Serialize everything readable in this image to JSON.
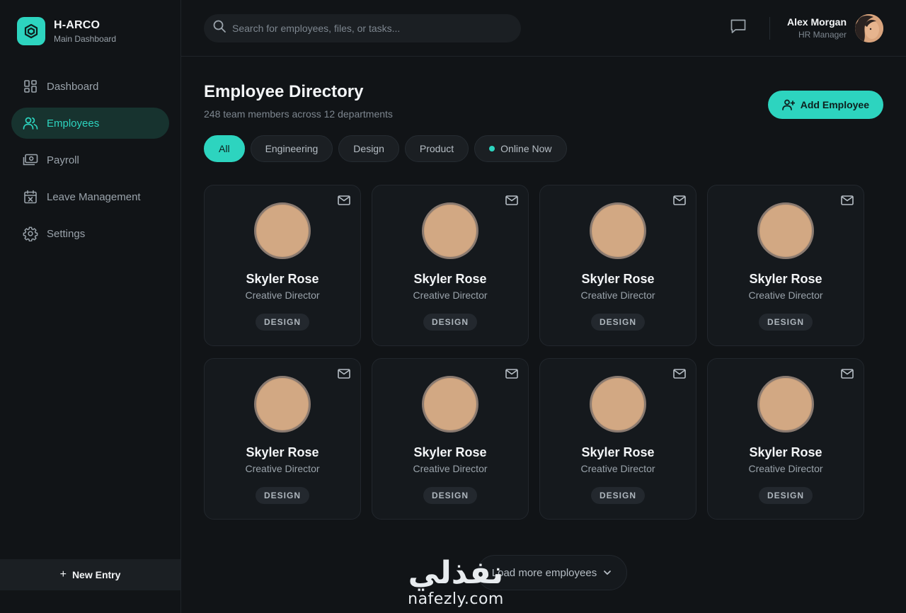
{
  "brand": {
    "title": "H-ARCO",
    "subtitle": "Main Dashboard"
  },
  "sidebar": {
    "items": [
      {
        "label": "Dashboard",
        "icon": "grid-icon",
        "active": false
      },
      {
        "label": "Employees",
        "icon": "users-icon",
        "active": true
      },
      {
        "label": "Payroll",
        "icon": "cash-icon",
        "active": false
      },
      {
        "label": "Leave Management",
        "icon": "calendar-x-icon",
        "active": false
      },
      {
        "label": "Settings",
        "icon": "gear-icon",
        "active": false
      }
    ],
    "new_entry_label": "New Entry"
  },
  "topbar": {
    "search_placeholder": "Search for employees, files, or tasks...",
    "user": {
      "name": "Alex Morgan",
      "role": "HR Manager"
    }
  },
  "page": {
    "title": "Employee Directory",
    "subtitle": "248 team members across 12 departments",
    "add_button_label": "Add Employee"
  },
  "filters": [
    {
      "label": "All",
      "active": true
    },
    {
      "label": "Engineering",
      "active": false
    },
    {
      "label": "Design",
      "active": false
    },
    {
      "label": "Product",
      "active": false
    },
    {
      "label": "Online Now",
      "active": false,
      "dot": true
    }
  ],
  "employees": [
    {
      "name": "Skyler Rose",
      "role": "Creative Director",
      "tag": "DESIGN"
    },
    {
      "name": "Skyler Rose",
      "role": "Creative Director",
      "tag": "DESIGN"
    },
    {
      "name": "Skyler Rose",
      "role": "Creative Director",
      "tag": "DESIGN"
    },
    {
      "name": "Skyler Rose",
      "role": "Creative Director",
      "tag": "DESIGN"
    },
    {
      "name": "Skyler Rose",
      "role": "Creative Director",
      "tag": "DESIGN"
    },
    {
      "name": "Skyler Rose",
      "role": "Creative Director",
      "tag": "DESIGN"
    },
    {
      "name": "Skyler Rose",
      "role": "Creative Director",
      "tag": "DESIGN"
    },
    {
      "name": "Skyler Rose",
      "role": "Creative Director",
      "tag": "DESIGN"
    }
  ],
  "load_more_label": "Load more employees",
  "watermark": {
    "arabic": "نفذلي",
    "latin": "nafezly.com"
  },
  "colors": {
    "accent": "#2dd4bf",
    "background": "#111417",
    "card": "#15191d"
  }
}
